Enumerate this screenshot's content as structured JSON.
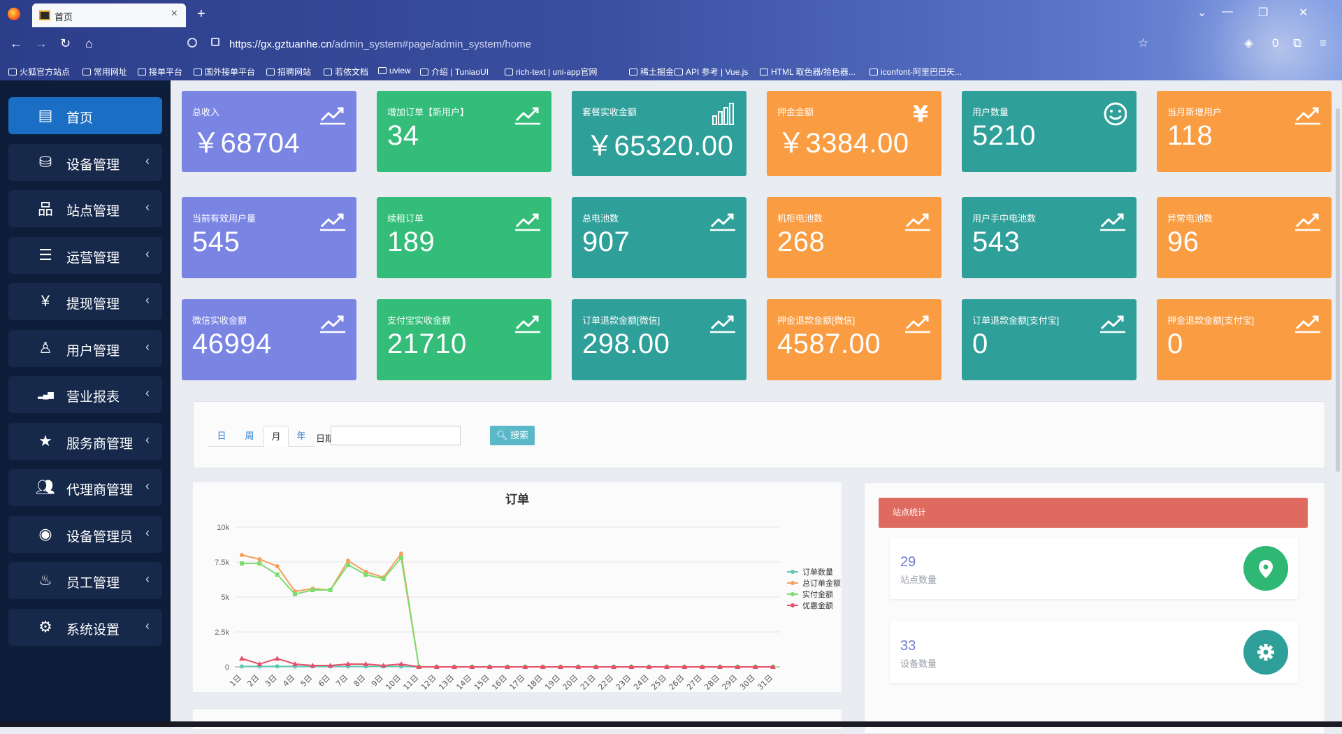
{
  "browser": {
    "tab_title": "首页",
    "url_host": "https://gx.gztuanhe.cn",
    "url_path": "/admin_system#page/admin_system/home",
    "bookmarks": [
      "火狐官方站点",
      "常用网址",
      "接单平台",
      "国外接单平台",
      "招聘网站",
      "若依文档",
      "uview",
      "介绍 | TuniaoUI",
      "rich-text | uni-app官网",
      "稀土掘金",
      "API 参考 | Vue.js",
      "HTML 取色器/拾色器...",
      "iconfont-阿里巴巴矢..."
    ],
    "ext_badge": "0"
  },
  "sidebar": {
    "items": [
      {
        "label": "首页",
        "icon": "dashboard-icon",
        "active": true
      },
      {
        "label": "设备管理",
        "icon": "hdd-icon"
      },
      {
        "label": "站点管理",
        "icon": "sitemap-icon"
      },
      {
        "label": "运营管理",
        "icon": "server-icon"
      },
      {
        "label": "提现管理",
        "icon": "yen-icon"
      },
      {
        "label": "用户管理",
        "icon": "user-icon"
      },
      {
        "label": "营业报表",
        "icon": "signal-icon"
      },
      {
        "label": "服务商管理",
        "icon": "star-icon"
      },
      {
        "label": "代理商管理",
        "icon": "users-icon"
      },
      {
        "label": "设备管理员",
        "icon": "user-circle-icon"
      },
      {
        "label": "员工管理",
        "icon": "fire-icon"
      },
      {
        "label": "系统设置",
        "icon": "gear-icon"
      }
    ]
  },
  "cards": [
    {
      "title": "总收入",
      "value": "￥68704",
      "color": "purple",
      "icon": "trend-icon"
    },
    {
      "title": "增加订单【新用户】",
      "value": "34",
      "color": "green",
      "icon": "trend-icon"
    },
    {
      "title": "套餐实收金额",
      "value": "￥65320.00",
      "color": "teal",
      "icon": "bar-chart-icon"
    },
    {
      "title": "押金金额",
      "value": "￥3384.00",
      "color": "orange",
      "icon": "yen-icon"
    },
    {
      "title": "用户数量",
      "value": "5210",
      "color": "teal",
      "icon": "smile-icon"
    },
    {
      "title": "当月新增用户",
      "value": "118",
      "color": "orange",
      "icon": "trend-icon"
    },
    {
      "title": "当前有效用户量",
      "value": "545",
      "color": "purple",
      "icon": "trend-icon"
    },
    {
      "title": "续租订单",
      "value": "189",
      "color": "green",
      "icon": "trend-icon"
    },
    {
      "title": "总电池数",
      "value": "907",
      "color": "teal",
      "icon": "trend-icon"
    },
    {
      "title": "机柜电池数",
      "value": "268",
      "color": "orange",
      "icon": "trend-icon"
    },
    {
      "title": "用户手中电池数",
      "value": "543",
      "color": "teal",
      "icon": "trend-icon"
    },
    {
      "title": "异常电池数",
      "value": "96",
      "color": "orange",
      "icon": "trend-icon"
    },
    {
      "title": "微信实收金额",
      "value": "46994",
      "color": "purple",
      "icon": "trend-icon"
    },
    {
      "title": "支付宝实收金额",
      "value": "21710",
      "color": "green",
      "icon": "trend-icon"
    },
    {
      "title": "订单退款金额[微信]",
      "value": "298.00",
      "color": "teal",
      "icon": "trend-icon"
    },
    {
      "title": "押金退款金额[微信]",
      "value": "4587.00",
      "color": "orange",
      "icon": "trend-icon"
    },
    {
      "title": "订单退款金额[支付宝]",
      "value": "0",
      "color": "teal",
      "icon": "trend-icon"
    },
    {
      "title": "押金退款金额[支付宝]",
      "value": "0",
      "color": "orange",
      "icon": "trend-icon"
    }
  ],
  "filter": {
    "periods": [
      "日",
      "周",
      "月",
      "年"
    ],
    "selected": "月",
    "date_label": "日期",
    "date_value": "",
    "search_label": "搜索"
  },
  "colors": {
    "purple": "#7a84e3",
    "green": "#33bd78",
    "teal": "#2f9f9a",
    "orange": "#fa9c41"
  },
  "chart_data": {
    "type": "line",
    "title": "订单",
    "categories": [
      "1日",
      "2日",
      "3日",
      "4日",
      "5日",
      "6日",
      "7日",
      "8日",
      "9日",
      "10日",
      "11日",
      "12日",
      "13日",
      "14日",
      "15日",
      "16日",
      "17日",
      "18日",
      "19日",
      "20日",
      "21日",
      "22日",
      "23日",
      "24日",
      "25日",
      "26日",
      "27日",
      "28日",
      "29日",
      "30日",
      "31日"
    ],
    "ylim": [
      0,
      10000
    ],
    "yticks": [
      "0",
      "2.5k",
      "5k",
      "7.5k",
      "10k"
    ],
    "legend_position": "right",
    "series": [
      {
        "name": "订单数量",
        "color": "#5cc9b5",
        "values": [
          30,
          40,
          40,
          30,
          30,
          30,
          30,
          30,
          30,
          30,
          0,
          0,
          0,
          0,
          0,
          0,
          0,
          0,
          0,
          0,
          0,
          0,
          0,
          0,
          0,
          0,
          0,
          0,
          0,
          0,
          0
        ]
      },
      {
        "name": "总订单金额",
        "color": "#f3a05d",
        "values": [
          8000,
          7700,
          7200,
          5400,
          5600,
          5500,
          7600,
          6800,
          6400,
          8100,
          0,
          0,
          0,
          0,
          0,
          0,
          0,
          0,
          0,
          0,
          0,
          0,
          0,
          0,
          0,
          0,
          0,
          0,
          0,
          0,
          0
        ]
      },
      {
        "name": "实付金额",
        "color": "#7ddc6e",
        "values": [
          7400,
          7400,
          6600,
          5200,
          5500,
          5500,
          7300,
          6600,
          6300,
          7800,
          0,
          0,
          0,
          0,
          0,
          0,
          0,
          0,
          0,
          0,
          0,
          0,
          0,
          0,
          0,
          0,
          0,
          0,
          0,
          0,
          0
        ]
      },
      {
        "name": "优惠金额",
        "color": "#e4506a",
        "values": [
          600,
          200,
          600,
          200,
          100,
          100,
          200,
          200,
          100,
          200,
          0,
          0,
          0,
          0,
          0,
          0,
          0,
          0,
          0,
          0,
          0,
          0,
          0,
          0,
          0,
          0,
          0,
          0,
          0,
          0,
          0
        ]
      }
    ]
  },
  "stats": {
    "title": "站点统计",
    "items": [
      {
        "value": "29",
        "label": "站点数量",
        "icon": "map-marker-icon",
        "color": "#2fb873"
      },
      {
        "value": "33",
        "label": "设备数量",
        "icon": "gear-icon",
        "color": "#2f9f9a"
      }
    ]
  }
}
